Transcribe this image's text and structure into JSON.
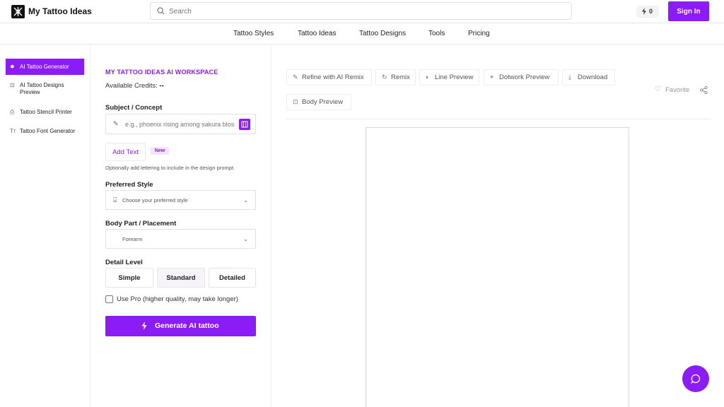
{
  "header": {
    "brand": "My Tattoo Ideas",
    "search_placeholder": "Search",
    "credits_count": "0",
    "sign_in": "Sign In"
  },
  "nav": [
    "Tattoo Styles",
    "Tattoo Ideas",
    "Tattoo Designs",
    "Tools",
    "Pricing"
  ],
  "sidebar": {
    "items": [
      {
        "label": "AI Tattoo Generator",
        "icon": "sparkle-icon",
        "active": true
      },
      {
        "label": "AI Tattoo Designs Preview",
        "icon": "scan-icon",
        "active": false
      },
      {
        "label": "Tattoo Stencil Printer",
        "icon": "printer-icon",
        "active": false
      },
      {
        "label": "Tattoo Font Generator",
        "icon": "font-icon",
        "active": false
      }
    ]
  },
  "workspace": {
    "title": "MY TATTOO IDEAS AI WORKSPACE",
    "credits_label": "Available Credits:",
    "credits_value": "--",
    "subject_label": "Subject / Concept",
    "subject_placeholder": "e.g., phoenix rising among sakura blossoms",
    "add_text": "Add Text",
    "new_badge": "New",
    "hint": "Optionally add lettering to include in the design prompt.",
    "style_label": "Preferred Style",
    "style_placeholder": "Choose your preferred style",
    "body_label": "Body Part / Placement",
    "body_value": "Forearm",
    "detail_label": "Detail Level",
    "detail_options": [
      "Simple",
      "Standard",
      "Detailed"
    ],
    "detail_selected": "Standard",
    "pro_label": "Use Pro (higher quality, may take longer)",
    "pro_checked": false,
    "generate": "Generate AI tattoo"
  },
  "toolbar": {
    "refine": "Refine with AI Remix",
    "remix": "Remix",
    "line_preview": "Line Preview",
    "dotwork_preview": "Dotwork Preview",
    "download": "Download",
    "body_preview": "Body Preview",
    "favorite": "Favorite"
  },
  "colors": {
    "accent": "#8b1cf6",
    "text": "#111111",
    "border": "#e6e6e6"
  }
}
